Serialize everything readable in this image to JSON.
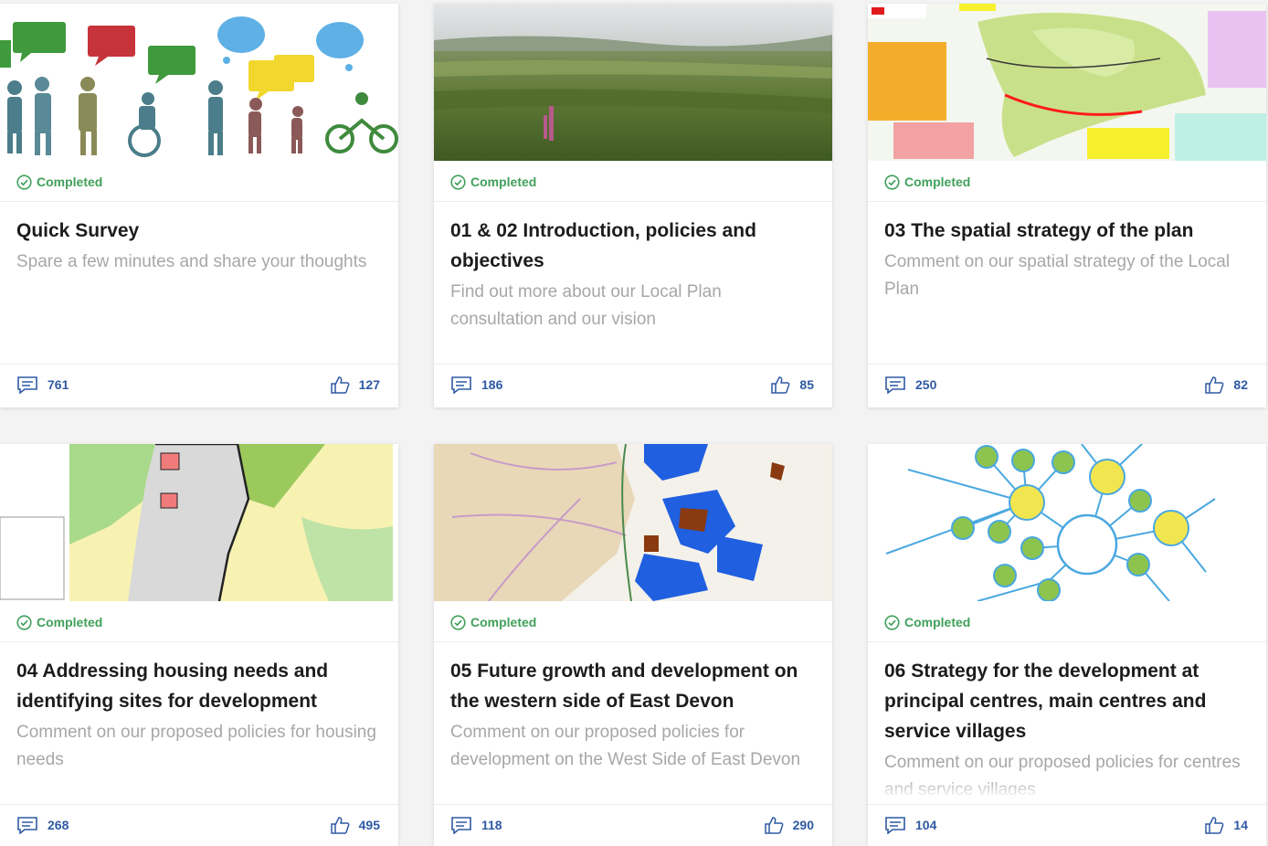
{
  "colors": {
    "status": "#41a05a",
    "stat": "#2f5aa3",
    "title": "#1c1c1c",
    "desc": "#a7a7a7"
  },
  "cards": [
    {
      "status": "Completed",
      "title": "Quick Survey",
      "description": "Spare a few minutes and share your thoughts",
      "comments": "761",
      "likes": "127",
      "image": "silhouettes-illustration",
      "comment_icon": "comment-icon",
      "like_icon": "thumbs-up-icon"
    },
    {
      "status": "Completed",
      "title": "01 & 02 Introduction, policies and objectives",
      "description": "Find out more about our Local Plan consultation and our vision",
      "comments": "186",
      "likes": "85",
      "image": "landscape-photo",
      "comment_icon": "comment-icon",
      "like_icon": "thumbs-up-icon"
    },
    {
      "status": "Completed",
      "title": "03 The spatial strategy of the plan",
      "description": "Comment on our spatial strategy of the Local Plan",
      "comments": "250",
      "likes": "82",
      "image": "spatial-strategy-map",
      "comment_icon": "comment-icon",
      "like_icon": "thumbs-up-icon"
    },
    {
      "status": "Completed",
      "title": "04 Addressing housing needs and identifying sites for development",
      "description": "Comment on our proposed policies for housing needs",
      "comments": "268",
      "likes": "495",
      "image": "housing-sites-map",
      "comment_icon": "comment-icon",
      "like_icon": "thumbs-up-icon"
    },
    {
      "status": "Completed",
      "title": "05 Future growth and development on the western side of East Devon",
      "description": "Comment on our proposed policies for development on the West Side of East Devon",
      "comments": "118",
      "likes": "290",
      "image": "western-growth-map",
      "comment_icon": "comment-icon",
      "like_icon": "thumbs-up-icon"
    },
    {
      "status": "Completed",
      "title": "06 Strategy for the development at principal centres, main centres and service villages",
      "description": "Comment on our proposed policies for centres and service villages",
      "comments": "104",
      "likes": "14",
      "image": "settlement-network-diagram",
      "comment_icon": "comment-icon",
      "like_icon": "thumbs-up-icon"
    }
  ]
}
